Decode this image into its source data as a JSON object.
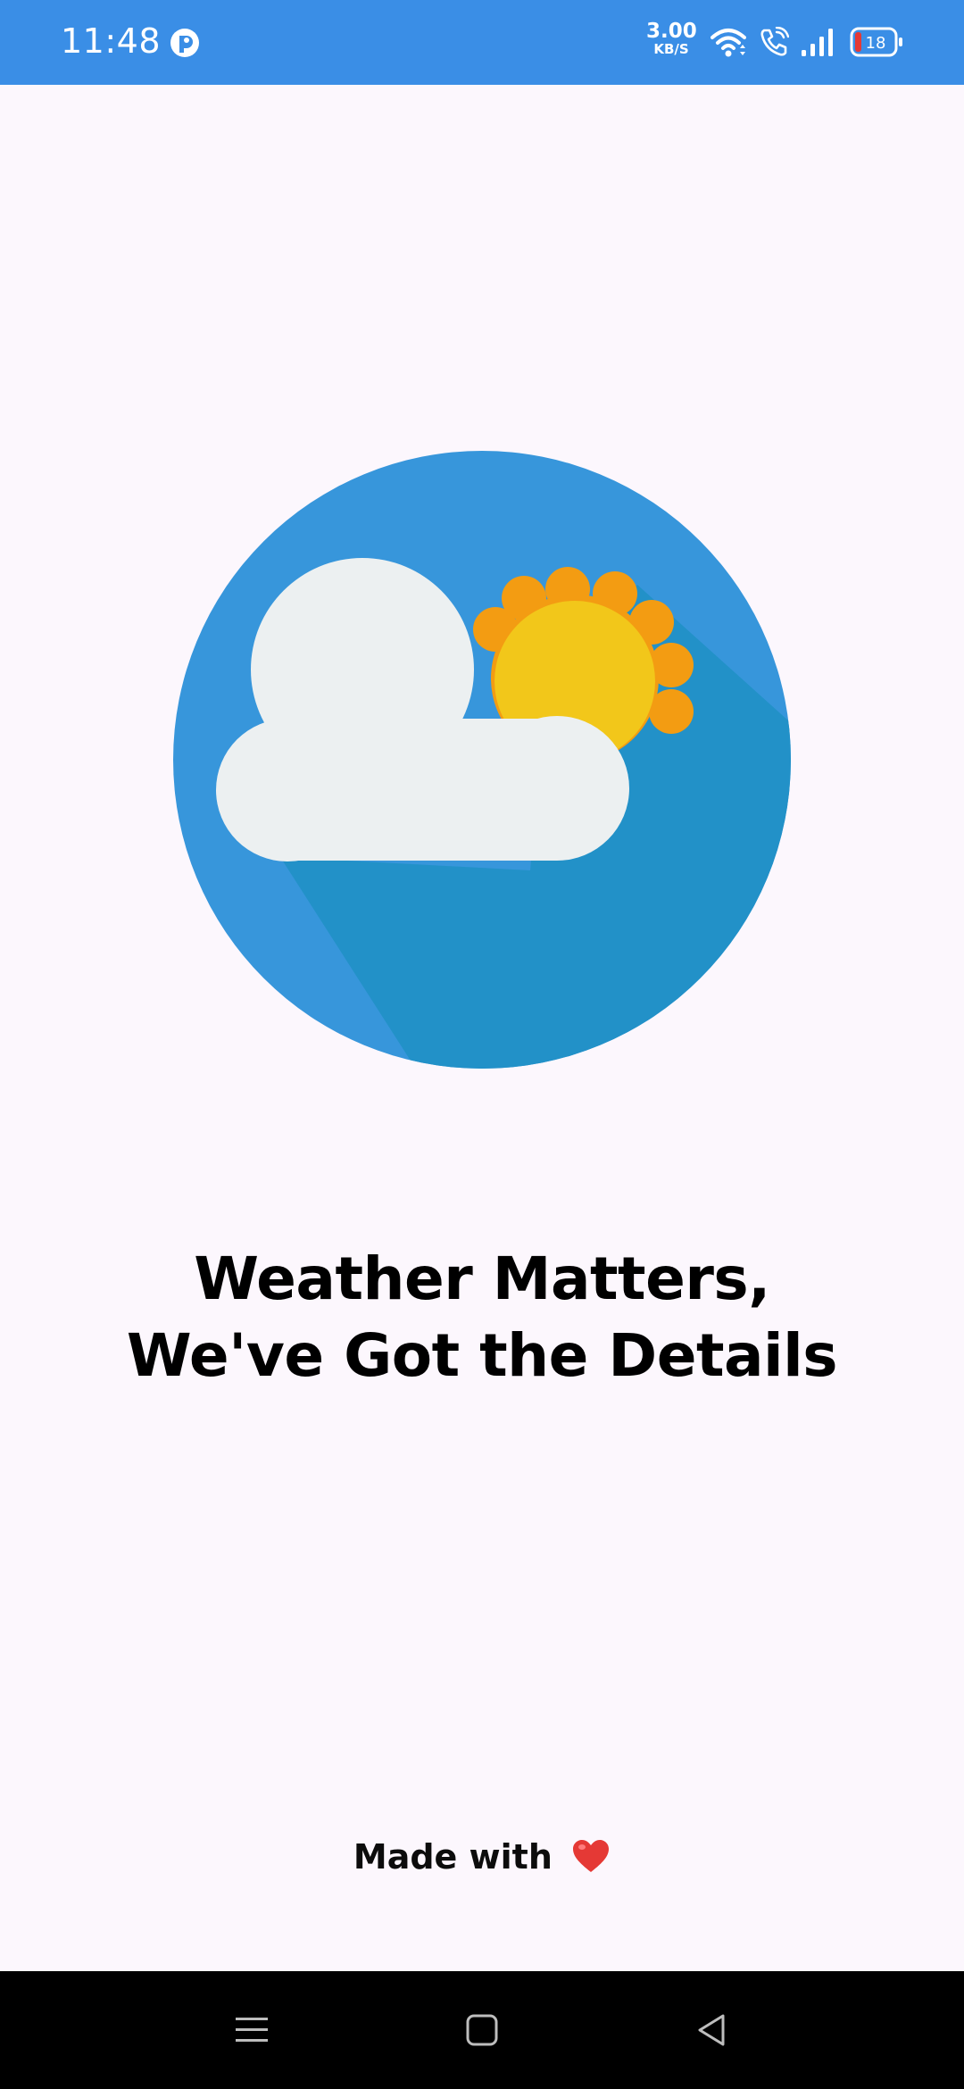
{
  "status_bar": {
    "time": "11:48",
    "net_speed_value": "3.00",
    "net_speed_unit": "KB/S",
    "battery_level": "18",
    "background_color": "#3a8ee6",
    "icons": [
      "app-notification-icon",
      "wifi-icon",
      "wifi-call-icon",
      "signal-icon",
      "battery-icon"
    ]
  },
  "logo": {
    "icon": "cloud-sun-icon",
    "colors": {
      "circle": "#3796db",
      "shadow": "#2291c8",
      "sun_rays": "#f39c12",
      "sun": "#f2c71a",
      "cloud": "#ecf0f1"
    }
  },
  "headline": {
    "line1": "Weather Matters,",
    "line2": "We've Got the Details"
  },
  "footer": {
    "made_with": "Made with",
    "heart_icon": "heart-icon",
    "heart_color": "#e53935"
  },
  "nav_bar": {
    "items": [
      "menu-icon",
      "home-icon",
      "back-icon"
    ]
  }
}
